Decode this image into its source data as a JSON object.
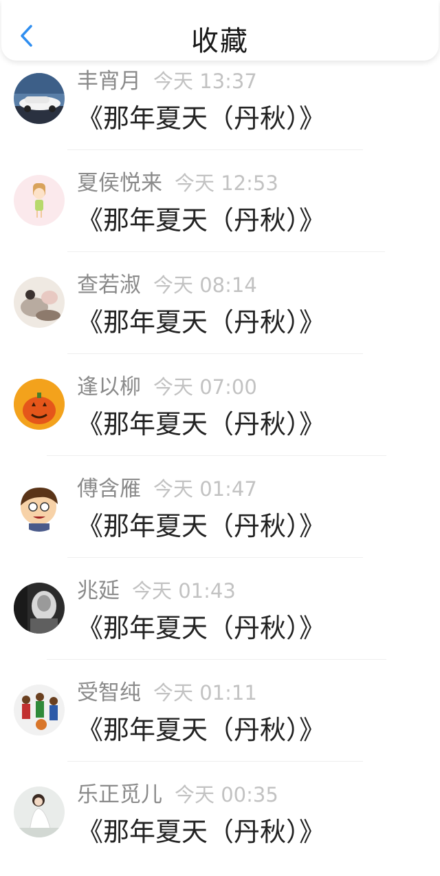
{
  "header": {
    "title": "收藏",
    "back_icon": "chevron-left-icon",
    "accent_color": "#2f8ef0"
  },
  "items": [
    {
      "name": "丰宵月",
      "time": "今天 13:37",
      "song": "《那年夏天（丹秋）》",
      "avatar": "white-car"
    },
    {
      "name": "夏侯悦来",
      "time": "今天 12:53",
      "song": "《那年夏天（丹秋）》",
      "avatar": "cartoon-girl"
    },
    {
      "name": "查若淑",
      "time": "今天 08:14",
      "song": "《那年夏天（丹秋）》",
      "avatar": "painting"
    },
    {
      "name": "逢以柳",
      "time": "今天 07:00",
      "song": "《那年夏天（丹秋）》",
      "avatar": "pumpkin"
    },
    {
      "name": "傅含雁",
      "time": "今天 01:47",
      "song": "《那年夏天（丹秋）》",
      "avatar": "cartoon-boy"
    },
    {
      "name": "兆延",
      "time": "今天 01:43",
      "song": "《那年夏天（丹秋）》",
      "avatar": "dark-photo"
    },
    {
      "name": "受智纯",
      "time": "今天 01:11",
      "song": "《那年夏天（丹秋）》",
      "avatar": "basketball-players"
    },
    {
      "name": "乐正觅儿",
      "time": "今天 00:35",
      "song": "《那年夏天（丹秋）》",
      "avatar": "girl-white-dress"
    }
  ]
}
